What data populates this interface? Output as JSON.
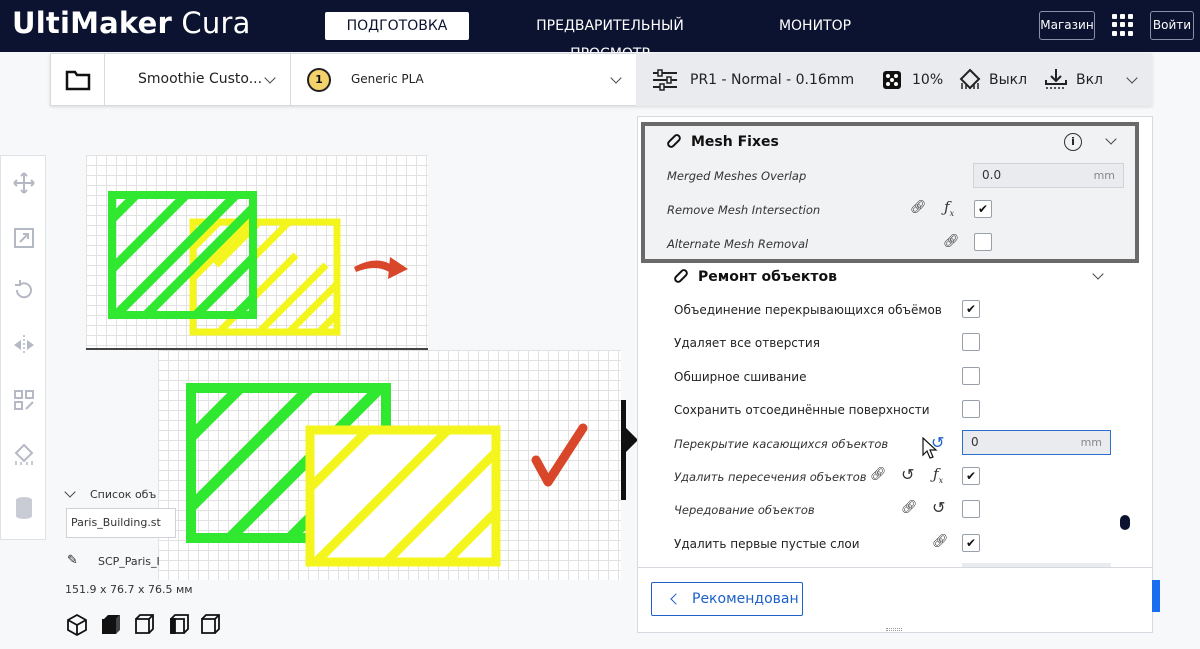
{
  "app": {
    "brand_bold": "UltiMaker",
    "brand_light": "Cura"
  },
  "nav": {
    "tabs": [
      {
        "label": "ПОДГОТОВКА",
        "active": true
      },
      {
        "label": "ПРЕДВАРИТЕЛЬНЫЙ ПРОСМОТР",
        "active": false
      },
      {
        "label": "МОНИТОР",
        "active": false
      }
    ]
  },
  "topright": {
    "shop": "Магазин",
    "login": "Войти"
  },
  "stage": {
    "printer": "Smoothie Custo...",
    "extruder_number": "1",
    "material": "Generic PLA",
    "profile": "PR1 - Normal - 0.16mm",
    "infill": "10%",
    "support": "Выкл",
    "adhesion": "Вкл"
  },
  "objects": {
    "header": "Список объ",
    "file": "Paris_Building.st",
    "project": "SCP_Paris_I",
    "dims": "151.9 x 76.7 x 76.5 мм"
  },
  "mesh_fixes": {
    "title": "Mesh Fixes",
    "overlap_label": "Merged Meshes Overlap",
    "overlap_value": "0.0",
    "overlap_unit": "mm",
    "remove_intersection": "Remove Mesh Intersection",
    "alternate_removal": "Alternate Mesh Removal"
  },
  "repair": {
    "title": "Ремонт объектов",
    "rows": [
      "Объединение перекрывающихся объёмов",
      "Удаляет все отверстия",
      "Обширное сшивание",
      "Сохранить отсоединённые поверхности",
      "Перекрытие касающихся объектов",
      "Удалить пересечения объектов",
      "Чередование объектов",
      "Удалить первые пустые слои"
    ],
    "overlap_value": "0",
    "overlap_unit": "mm"
  },
  "footer": {
    "recommended": "Рекомендован"
  },
  "colors": {
    "topbar": "#0c1330",
    "accent": "#196ef0",
    "green": "#2fe82f",
    "yellow": "#f5f51e",
    "red": "#d9472b"
  }
}
